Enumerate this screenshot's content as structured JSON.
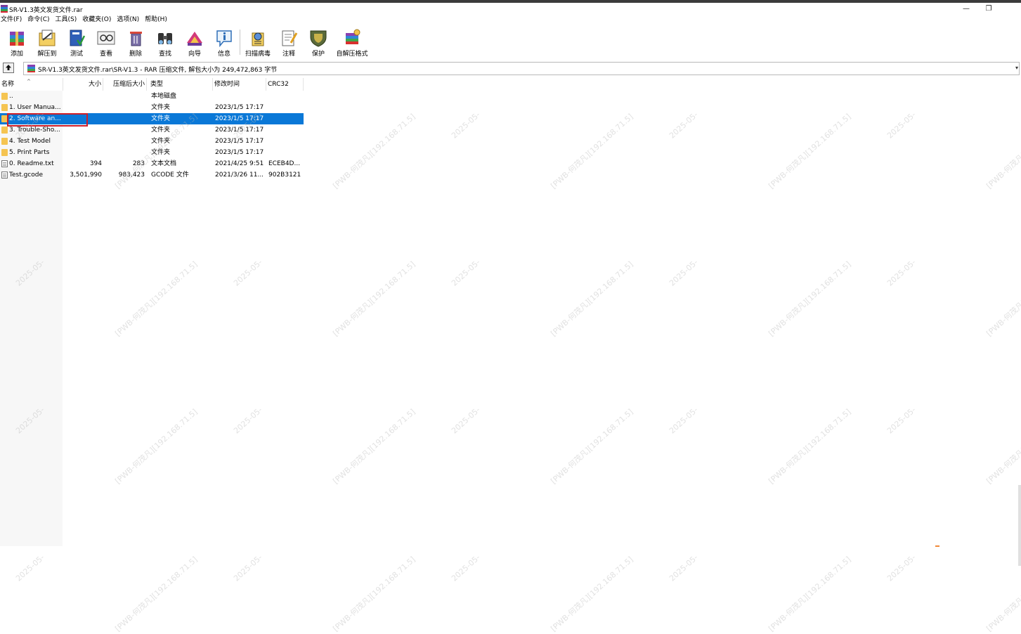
{
  "window": {
    "title": "SR-V1.3英文发货文件.rar",
    "controls": {
      "minimize": "—",
      "restore": "❐"
    }
  },
  "menu": [
    "文件(F)",
    "命令(C)",
    "工具(S)",
    "收藏夹(O)",
    "选项(N)",
    "帮助(H)"
  ],
  "toolbar": [
    {
      "label": "添加",
      "icon": "add-archive-icon"
    },
    {
      "label": "解压到",
      "icon": "extract-to-icon"
    },
    {
      "label": "测试",
      "icon": "test-icon"
    },
    {
      "label": "查看",
      "icon": "view-icon"
    },
    {
      "label": "删除",
      "icon": "delete-icon"
    },
    {
      "label": "查找",
      "icon": "find-icon"
    },
    {
      "label": "向导",
      "icon": "wizard-icon"
    },
    {
      "label": "信息",
      "icon": "info-icon"
    },
    {
      "label": "扫描病毒",
      "icon": "virus-scan-icon"
    },
    {
      "label": "注释",
      "icon": "comment-icon"
    },
    {
      "label": "保护",
      "icon": "protect-icon"
    },
    {
      "label": "自解压格式",
      "icon": "sfx-icon"
    }
  ],
  "address": {
    "text": "SR-V1.3英文发货文件.rar\\SR-V1.3 - RAR 压缩文件, 解包大小为 249,472,863 字节"
  },
  "columns": {
    "name": "名称",
    "size": "大小",
    "packed": "压缩后大小",
    "type": "类型",
    "modified": "修改时间",
    "crc": "CRC32",
    "sort_indicator": "^"
  },
  "files": [
    {
      "name": "..",
      "size": "",
      "packed": "",
      "type": "本地磁盘",
      "modified": "",
      "crc": "",
      "kind": "up"
    },
    {
      "name": "1. User Manua...",
      "size": "",
      "packed": "",
      "type": "文件夹",
      "modified": "2023/1/5 17:17",
      "crc": "",
      "kind": "folder"
    },
    {
      "name": "2. Software an...",
      "size": "",
      "packed": "",
      "type": "文件夹",
      "modified": "2023/1/5 17:17",
      "crc": "",
      "kind": "folder",
      "selected": true
    },
    {
      "name": "3. Trouble-Sho...",
      "size": "",
      "packed": "",
      "type": "文件夹",
      "modified": "2023/1/5 17:17",
      "crc": "",
      "kind": "folder"
    },
    {
      "name": "4. Test Model",
      "size": "",
      "packed": "",
      "type": "文件夹",
      "modified": "2023/1/5 17:17",
      "crc": "",
      "kind": "folder"
    },
    {
      "name": "5. Print Parts",
      "size": "",
      "packed": "",
      "type": "文件夹",
      "modified": "2023/1/5 17:17",
      "crc": "",
      "kind": "folder"
    },
    {
      "name": "0. Readme.txt",
      "size": "394",
      "packed": "283",
      "type": "文本文档",
      "modified": "2021/4/25 9:51",
      "crc": "ECEB4D...",
      "kind": "file"
    },
    {
      "name": "Test.gcode",
      "size": "3,501,990",
      "packed": "983,423",
      "type": "GCODE 文件",
      "modified": "2021/3/26 11...",
      "crc": "902B3121",
      "kind": "file"
    }
  ],
  "colors": {
    "selection": "#0a78d7",
    "highlight_box": "#cc1f2a"
  },
  "watermark": {
    "text": "[PWB-何茂凡][192.168.71.5]",
    "date": "2025-05-"
  }
}
